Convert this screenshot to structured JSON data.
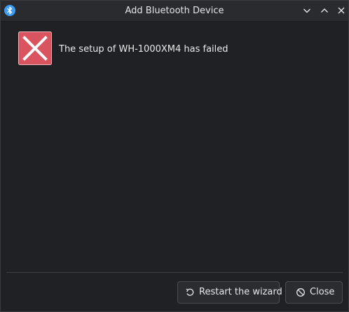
{
  "window": {
    "title": "Add Bluetooth Device",
    "app_icon": "bluetooth-icon",
    "controls": [
      "minimize-icon",
      "maximize-icon",
      "close-icon"
    ]
  },
  "content": {
    "status_icon": "error-icon",
    "message": "The setup of WH-1000XM4 has failed"
  },
  "footer": {
    "restart_label": "Restart the wizard",
    "restart_icon": "restart-icon",
    "close_label": "Close",
    "close_icon": "cancel-icon"
  },
  "colors": {
    "error_red": "#d9545f",
    "accent_blue": "#3d9df5",
    "background": "#202124"
  }
}
